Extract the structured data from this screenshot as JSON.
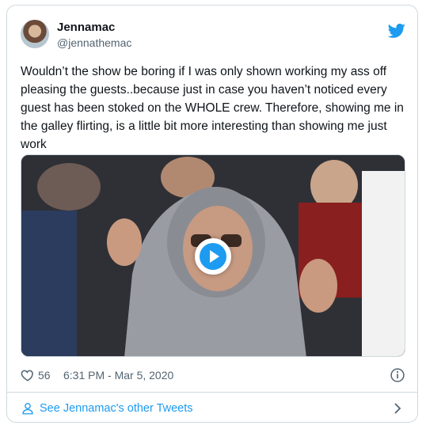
{
  "tweet": {
    "author_name": "Jennamac",
    "author_handle": "@jennathemac",
    "text": "Wouldn’t the show be boring if I was only shown working my ass off pleasing the guests..because just in case you haven’t noticed every guest has been stoked on the WHOLE crew. Therefore, showing me in the galley flirting, is a little bit more interesting than showing me just work",
    "likes": "56",
    "timestamp": "6:31 PM - Mar 5, 2020"
  },
  "footer": {
    "link_label": "See Jennamac's other Tweets"
  },
  "icons": {
    "brand": "twitter-bird-icon",
    "like": "heart-icon",
    "info": "info-icon",
    "profile": "person-icon",
    "next": "chevron-right-icon",
    "media": "play-icon"
  },
  "colors": {
    "accent": "#1d9bf0",
    "text": "#0f1419",
    "muted": "#536471",
    "border": "#cfd9de"
  }
}
